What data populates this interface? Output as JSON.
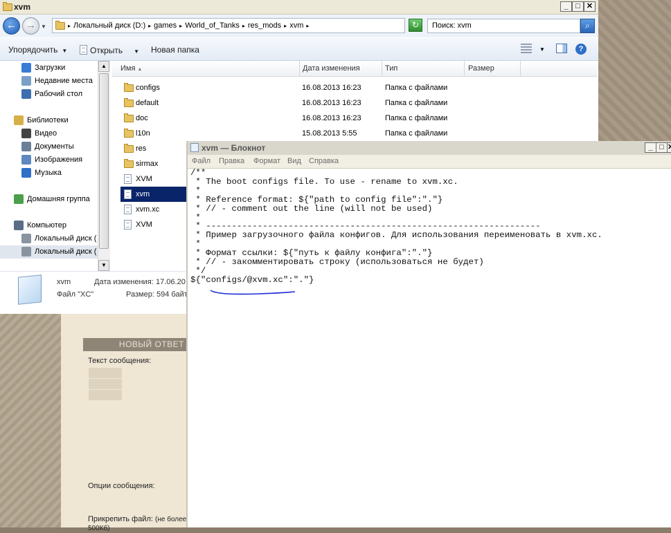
{
  "explorer": {
    "title": "xvm",
    "breadcrumbs": [
      "Локальный диск (D:)",
      "games",
      "World_of_Tanks",
      "res_mods",
      "xvm"
    ],
    "search_placeholder": "Поиск: xvm",
    "toolbar": {
      "organize": "Упорядочить",
      "open": "Открыть",
      "new_folder": "Новая папка"
    },
    "nav": {
      "items": [
        {
          "label": "Загрузки",
          "icon": "downloads-icon"
        },
        {
          "label": "Недавние места",
          "icon": "recent-places-icon"
        },
        {
          "label": "Рабочий стол",
          "icon": "desktop-icon"
        },
        {
          "label": "Библиотеки",
          "icon": "libraries-icon"
        },
        {
          "label": "Видео",
          "icon": "video-icon"
        },
        {
          "label": "Документы",
          "icon": "documents-icon"
        },
        {
          "label": "Изображения",
          "icon": "pictures-icon"
        },
        {
          "label": "Музыка",
          "icon": "music-icon"
        },
        {
          "label": "Домашняя группа",
          "icon": "homegroup-icon"
        },
        {
          "label": "Компьютер",
          "icon": "computer-icon"
        },
        {
          "label": "Локальный диск (",
          "icon": "drive-c-icon"
        },
        {
          "label": "Локальный диск (",
          "icon": "drive-d-icon"
        }
      ]
    },
    "columns": {
      "name": "Имя",
      "date": "Дата изменения",
      "type": "Тип",
      "size": "Размер"
    },
    "files": [
      {
        "name": "configs",
        "date": "16.08.2013 16:23",
        "type": "Папка с файлами"
      },
      {
        "name": "default",
        "date": "16.08.2013 16:23",
        "type": "Папка с файлами"
      },
      {
        "name": "doc",
        "date": "16.08.2013 16:23",
        "type": "Папка с файлами"
      },
      {
        "name": "l10n",
        "date": "15.08.2013 5:55",
        "type": "Папка с файлами"
      },
      {
        "name": "res",
        "date": "",
        "type": ""
      },
      {
        "name": "sirmax",
        "date": "",
        "type": ""
      },
      {
        "name": "XVM",
        "date": "",
        "type": ""
      },
      {
        "name": "xvm",
        "date": "",
        "type": ""
      },
      {
        "name": "xvm.xc",
        "date": "",
        "type": ""
      },
      {
        "name": "XVM",
        "date": "",
        "type": ""
      }
    ],
    "details": {
      "name": "xvm",
      "type": "Файл \"XC\"",
      "modified_label": "Дата изменения:",
      "modified_value": "17.06.20",
      "size_label": "Размер:",
      "size_value": "594 байт"
    }
  },
  "notepad": {
    "title": "xvm — Блокнот",
    "menu": [
      "Файл",
      "Правка",
      "Формат",
      "Вид",
      "Справка"
    ],
    "content": "/**\n * The boot configs file. To use - rename to xvm.xc.\n *\n * Reference format: ${\"path to config file\":\".\"}\n * // - comment out the line (will not be used)\n *\n * -----------------------------------------------------------------\n * Пример загрузочного файла конфигов. Для использования переименовать в xvm.xc.\n *\n * Формат ссылки: ${\"путь к файлу конфига\":\".\"}\n * // - закомментировать строку (использоваться не будет)\n */\n${\"configs/@xvm.xc\":\".\"}"
  },
  "forum": {
    "reply_header": "НОВЫЙ ОТВЕТ",
    "message_label": "Текст сообщения:",
    "options_label": "Опции сообщения:",
    "attach_label": "Прикрепить файл:",
    "attach_note": "(не более 500Кб)"
  },
  "colors": {
    "selection": "#0a246a",
    "annotation": "#1c2bd6"
  }
}
